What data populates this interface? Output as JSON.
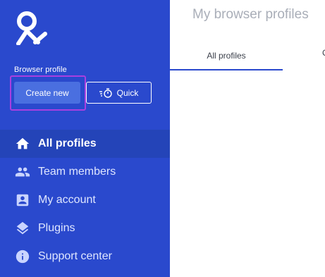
{
  "sidebar": {
    "brand_logo_icon": "brand-logo-icon",
    "section_label": "Browser profile",
    "create_button": "Create new",
    "quick_button": "Quick",
    "quick_icon": "stopwatch-icon",
    "nav": [
      {
        "label": "All profiles",
        "icon": "home-icon",
        "active": true
      },
      {
        "label": "Team members",
        "icon": "people-icon",
        "active": false
      },
      {
        "label": "My account",
        "icon": "account-box-icon",
        "active": false
      },
      {
        "label": "Plugins",
        "icon": "layers-icon",
        "active": false
      },
      {
        "label": "Support center",
        "icon": "info-icon",
        "active": false
      }
    ]
  },
  "main": {
    "title": "My browser profiles",
    "tabs": [
      {
        "label": "All profiles",
        "active": true
      },
      {
        "label": "C"
      }
    ]
  },
  "colors": {
    "sidebar_bg": "#2a49cd",
    "active_nav_bg": "#2444b8",
    "focus_outline": "#a83fe0",
    "tab_underline": "#2a49cd"
  }
}
